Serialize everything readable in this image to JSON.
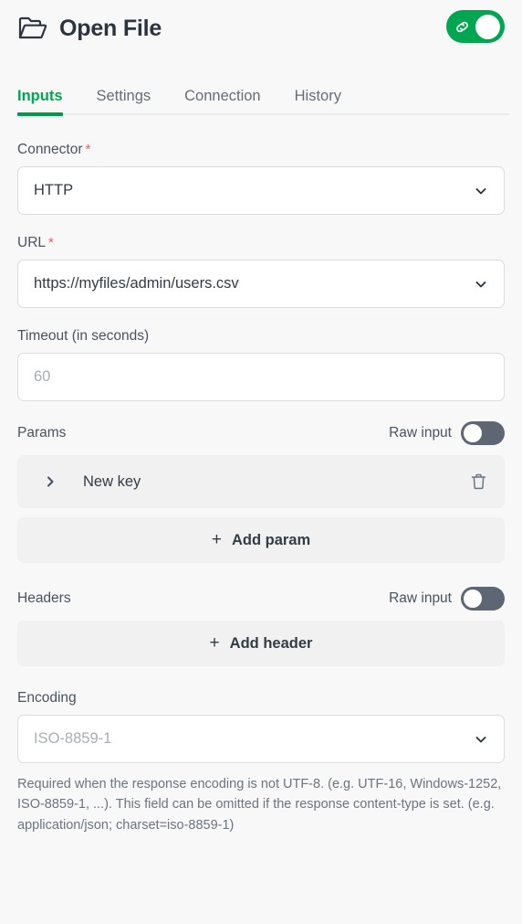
{
  "header": {
    "title": "Open File",
    "folder_icon": "open-folder-icon",
    "connection_toggle": {
      "icon": "link-chain-icon",
      "state": "on",
      "color": "#00a650"
    }
  },
  "tabs": [
    {
      "label": "Inputs",
      "active": true
    },
    {
      "label": "Settings",
      "active": false
    },
    {
      "label": "Connection",
      "active": false
    },
    {
      "label": "History",
      "active": false
    }
  ],
  "form": {
    "connector": {
      "label": "Connector",
      "required_marker": "*",
      "value": "HTTP",
      "chevron": "chevron-down-icon"
    },
    "url": {
      "label": "URL",
      "required_marker": "*",
      "value": "https://myfiles/admin/users.csv",
      "chevron": "chevron-down-icon"
    },
    "timeout": {
      "label": "Timeout (in seconds)",
      "placeholder": "60",
      "value": ""
    },
    "params": {
      "title": "Params",
      "raw_input_label": "Raw input",
      "raw_input_state": "off",
      "rows": [
        {
          "expand_icon": "chevron-right-icon",
          "key": "New key",
          "delete_icon": "trash-icon"
        }
      ],
      "add_label": "Add param",
      "add_icon": "plus-icon"
    },
    "headers": {
      "title": "Headers",
      "raw_input_label": "Raw input",
      "raw_input_state": "off",
      "add_label": "Add header",
      "add_icon": "plus-icon"
    },
    "encoding": {
      "label": "Encoding",
      "placeholder": "ISO-8859-1",
      "value": "",
      "chevron": "chevron-down-icon",
      "help": "Required when the response encoding is not UTF-8. (e.g. UTF-16, Windows-1252, ISO-8859-1, ...). This field can be omitted if the response content-type is set. (e.g. application/json; charset=iso-8859-1)"
    }
  },
  "colors": {
    "accent_green": "#00a650",
    "required_red": "#e8606d",
    "toggle_off_grey": "#5f6673",
    "panel_grey": "#f1f1f2",
    "page_background": "#f8f8f8"
  }
}
